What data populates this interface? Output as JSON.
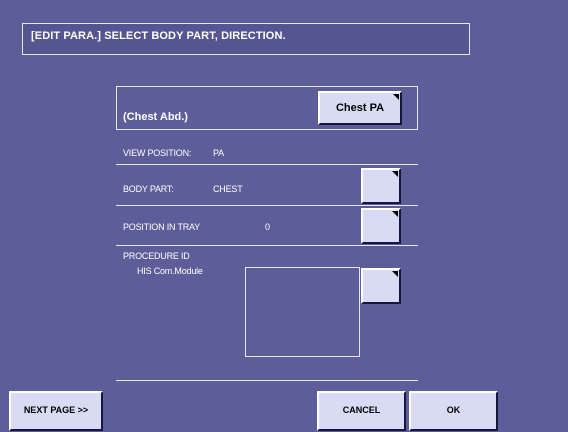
{
  "header": {
    "title": "[EDIT PARA.] SELECT BODY PART, DIRECTION."
  },
  "exam": {
    "name": "(Chest Abd.)",
    "selected_button": "Chest PA"
  },
  "fields": {
    "view_position": {
      "label": "VIEW POSITION:",
      "value": "PA"
    },
    "body_part": {
      "label": "BODY PART:",
      "value": "CHEST"
    },
    "position_in_tray": {
      "label": "POSITION IN TRAY",
      "value": "0"
    },
    "procedure_id": {
      "label": "PROCEDURE ID",
      "sub_label": "HIS Com.Module"
    }
  },
  "footer": {
    "next_page": "NEXT PAGE >>",
    "cancel": "CANCEL",
    "ok": "OK"
  },
  "colors": {
    "background": "#5d5d9a",
    "button_face": "#d9daf3",
    "line": "#e6e6f2"
  }
}
